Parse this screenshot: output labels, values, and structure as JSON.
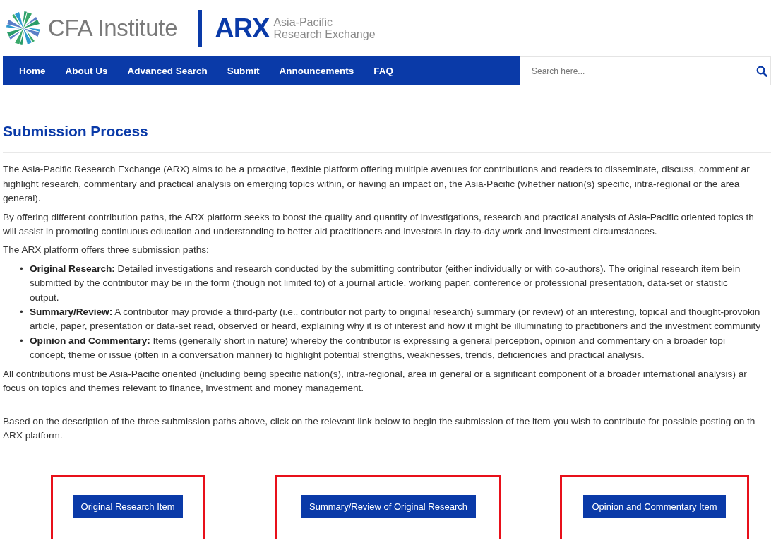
{
  "header": {
    "org_name": "CFA Institute",
    "brand": "ARX",
    "tagline": "Asia-Pacific\nResearch Exchange"
  },
  "nav": {
    "items": [
      {
        "label": "Home"
      },
      {
        "label": "About Us"
      },
      {
        "label": "Advanced Search"
      },
      {
        "label": "Submit"
      },
      {
        "label": "Announcements"
      },
      {
        "label": "FAQ"
      }
    ],
    "search": {
      "placeholder": "Search here..."
    }
  },
  "page_title": "Submission Process",
  "content": [
    {
      "kind": "paragraph",
      "text": "The Asia-Pacific Research Exchange (ARX) aims to be a proactive, flexible platform offering multiple avenues for contributions and readers to disseminate, discuss, comment ar\nhighlight research, commentary and practical analysis on emerging topics within, or having an impact on, the Asia-Pacific (whether nation(s) specific, intra-regional or the area\ngeneral)."
    },
    {
      "kind": "paragraph",
      "text": "By offering different contribution paths, the ARX platform seeks to boost the quality and quantity of investigations, research and practical analysis of Asia-Pacific oriented topics th\nwill assist in promoting continuous education and understanding to better aid practitioners and investors in day-to-day work and investment circumstances."
    },
    {
      "kind": "paragraph",
      "text": "The ARX platform offers three submission paths:"
    },
    {
      "kind": "list",
      "items": [
        {
          "marker": "•",
          "text": "**Original Research:** Detailed investigations and research conducted by the submitting contributor (either individually or with co-authors). The original research item bein\nsubmitted by the contributor may be in the form (though not limited to) of a journal article, working paper, conference or professional presentation, data-set or statistic\noutput."
        },
        {
          "marker": "•",
          "text": "**Summary/Review:** A contributor may provide a third-party (i.e., contributor not party to original research) summary (or review) of an interesting, topical and thought-provokin\narticle, paper, presentation or data-set read, observed or heard, explaining why it is of interest and how it might be illuminating to practitioners and the investment community"
        },
        {
          "marker": "•",
          "text": "**Opinion and Commentary:** Items (generally short in nature) whereby the contributor is expressing a general perception, opinion and commentary on a broader topi\nconcept, theme or issue (often in a conversation manner) to highlight potential strengths, weaknesses, trends, deficiencies and practical analysis."
        }
      ]
    },
    {
      "kind": "paragraph",
      "text": "All contributions must be Asia-Pacific oriented (including being specific nation(s), intra-regional, area in general or a significant component of a broader international analysis) ar\nfocus on topics and themes relevant to finance, investment and money management."
    },
    {
      "kind": "gap"
    },
    {
      "kind": "paragraph",
      "text": "Based on the description of the three submission paths above, click on the relevant link below to begin the submission of the item you wish to contribute for possible posting on th\nARX platform."
    }
  ],
  "submit_options": [
    {
      "label": "Original Research Item",
      "highlighted": true
    },
    {
      "label": "Summary/Review of Original Research",
      "highlighted": true
    },
    {
      "label": "Opinion and Commentary Item",
      "highlighted": true
    }
  ]
}
